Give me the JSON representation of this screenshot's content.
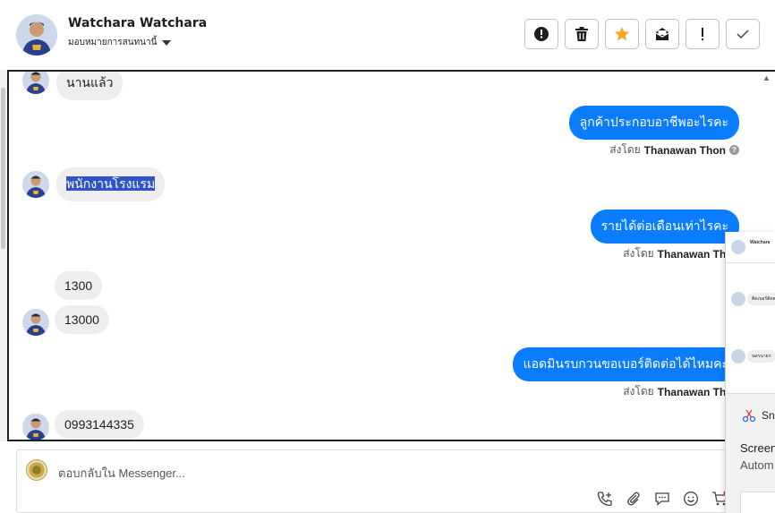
{
  "header": {
    "name": "Watchara Watchara",
    "assign_label": "มอบหมายการสนทนานี้"
  },
  "toolbar": {
    "buttons": [
      {
        "icon": "alert-circle-icon"
      },
      {
        "icon": "trash-icon"
      },
      {
        "icon": "star-icon",
        "color": "#f5a623"
      },
      {
        "icon": "mark-unread-icon"
      },
      {
        "icon": "exclamation-icon"
      },
      {
        "icon": "check-icon"
      }
    ]
  },
  "messages": [
    {
      "from": "customer",
      "text": "นานแล้ว"
    },
    {
      "from": "page",
      "text": "ลูกค้าประกอบอาชีพอะไรคะ",
      "sent_by_label": "ส่งโดย",
      "sent_by_name": "Thanawan Thon"
    },
    {
      "from": "customer",
      "text": "พนักงานโรงแรม"
    },
    {
      "from": "page",
      "text": "รายได้ต่อเดือนเท่าไรคะ",
      "sent_by_label": "ส่งโดย",
      "sent_by_name": "Thanawan Thon"
    },
    {
      "from": "customer",
      "text": "1300"
    },
    {
      "from": "customer",
      "text": "13000"
    },
    {
      "from": "page",
      "text": "แอดมินรบกวนขอเบอร์ติดต่อได้ไหมคะ",
      "sent_by_label": "ส่งโดย",
      "sent_by_name": "Thanawan Thon"
    },
    {
      "from": "customer",
      "text": "0993144335"
    }
  ],
  "composer": {
    "placeholder": "ตอบกลับใน Messenger..."
  },
  "overlay": {
    "mini_name": "Watchara",
    "mini_bubble_1": "ติดเบอร์ติดต",
    "mini_bubble_2": "นครนายก",
    "snip_label": "Sni",
    "text_1": "Screen",
    "text_2": "Autom"
  },
  "colors": {
    "outgoing_bubble": "#0a7cff",
    "incoming_bubble": "#eeeeee",
    "highlight": "#2f53c8"
  }
}
